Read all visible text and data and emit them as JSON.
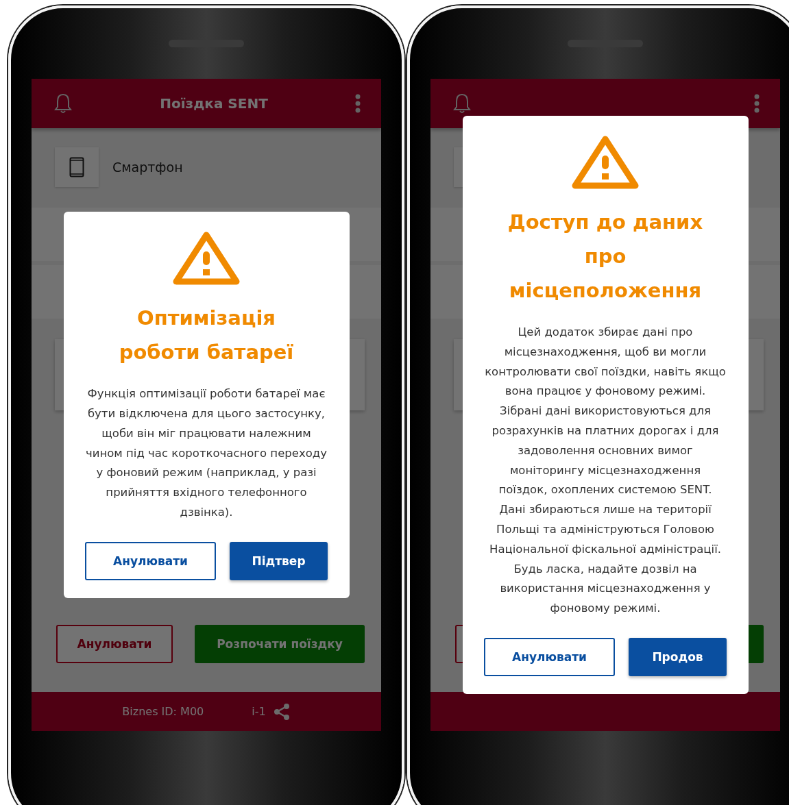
{
  "phones": [
    {
      "screen": {
        "header": {
          "title": "Поїздка SENT"
        },
        "device_card": {
          "label": "Смартфон"
        },
        "rows": [
          {
            "kind": "toggle"
          },
          {
            "kind": "link"
          },
          {
            "kind": "card"
          }
        ],
        "actions": [
          {
            "kind": "outline",
            "label": "Анулювати"
          },
          {
            "kind": "primary",
            "label": "Розпочати поїздку"
          }
        ],
        "footer": {
          "business_id": "Biznes ID:  M00",
          "suffix": "i-1"
        }
      },
      "dialog": {
        "title": "Оптимізація роботи батареї",
        "message": "Функція оптимізації роботи батареї має бути відключена для цього застосунку, щоби він міг працювати належним чином під час короткочасного переходу у фоновий режим (наприклад, у разі прийняття вхідного телефонного дзвінка).",
        "buttons": [
          {
            "kind": "outline",
            "label": "Анулювати"
          },
          {
            "kind": "filled",
            "label": "Підтвер"
          }
        ]
      }
    },
    {
      "screen": {
        "rows": [
          {
            "kind": "toggle"
          },
          {
            "kind": "link"
          },
          {
            "kind": "card"
          }
        ],
        "actions": [
          {
            "kind": "outline"
          },
          {
            "kind": "primary"
          }
        ]
      },
      "dialog": {
        "title": "Доступ до даних про місцеположення",
        "message": "Цей додаток збирає дані про місцезнаходження, щоб ви могли контролювати свої поїздки, навіть якщо вона працює у фоновому режимі. Зібрані дані використовуються для розрахунків на платних дорогах і для задоволення основних вимог моніторингу місцезнаходження поїздок, охоплених системою SENT. Дані збираються лише на території Польщі та адмініструються Головою Національної фіскальної адміністрації. Будь ласка, надайте дозвіл на використання місцезнаходження у фоновому режимі.",
        "buttons": [
          {
            "kind": "outline",
            "label": "Анулювати"
          },
          {
            "kind": "filled",
            "label": "Продов"
          }
        ]
      }
    }
  ]
}
